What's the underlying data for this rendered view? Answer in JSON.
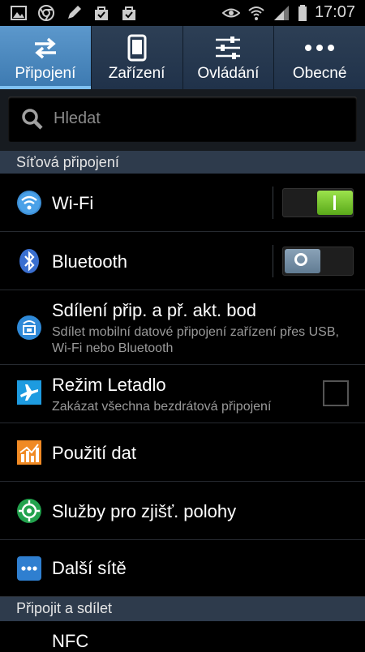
{
  "status_bar": {
    "time": "17:07",
    "left_icons": [
      "gallery-icon",
      "chrome-icon",
      "pen-icon",
      "shopping-bag-icon",
      "shopping-bag-check-icon"
    ],
    "right_icons": [
      "eye-icon",
      "wifi-signal-icon",
      "cell-signal-icon",
      "battery-icon"
    ]
  },
  "tabs": [
    {
      "label": "Připojení",
      "icon": "arrows-swap-icon",
      "active": true
    },
    {
      "label": "Zařízení",
      "icon": "phone-device-icon",
      "active": false
    },
    {
      "label": "Ovládání",
      "icon": "sliders-icon",
      "active": false
    },
    {
      "label": "Obecné",
      "icon": "more-dots-icon",
      "active": false
    }
  ],
  "search": {
    "placeholder": "Hledat"
  },
  "sections": {
    "network": "Síťová připojení",
    "connect_share": "Připojit a sdílet"
  },
  "rows": {
    "wifi": {
      "title": "Wi-Fi",
      "toggle": "on"
    },
    "bluetooth": {
      "title": "Bluetooth",
      "toggle": "off"
    },
    "tethering": {
      "title": "Sdílení přip. a př. akt. bod",
      "subtitle": "Sdílet mobilní datové připojení zařízení přes USB, Wi-Fi nebo Bluetooth"
    },
    "airplane": {
      "title": "Režim Letadlo",
      "subtitle": "Zakázat všechna bezdrátová připojení",
      "checked": false
    },
    "data_usage": {
      "title": "Použití dat"
    },
    "location": {
      "title": "Služby pro zjišť. polohy"
    },
    "more_networks": {
      "title": "Další sítě"
    },
    "nfc": {
      "title": "NFC"
    }
  },
  "colors": {
    "accent": "#4a89c0",
    "section_bg": "#2e3b4c",
    "toggle_on": "#7cc93a"
  }
}
